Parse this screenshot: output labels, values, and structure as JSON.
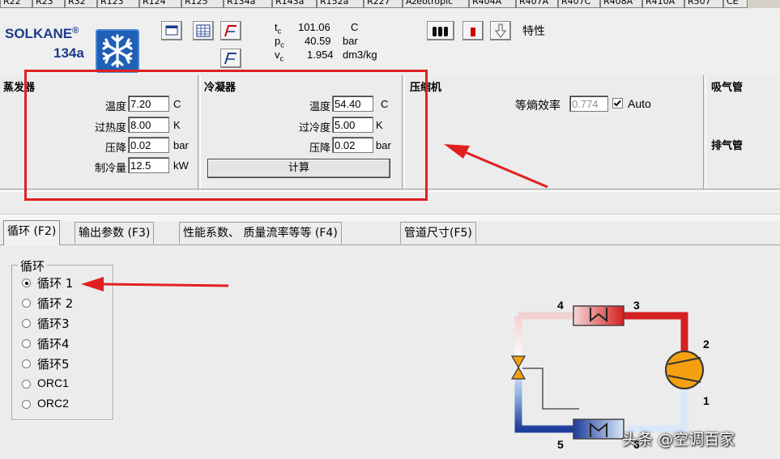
{
  "refrigerant_tabs": [
    "R22",
    "R23",
    "R32",
    "R123",
    "R124",
    "R125",
    "R134a",
    "R143a",
    "R152a",
    "R227",
    "Azeotropic",
    "R404A",
    "R407A",
    "R407C",
    "R408A",
    "R410A",
    "R507",
    "CE"
  ],
  "logo": {
    "brand": "SOLKANE",
    "reg": "®",
    "model": "134a"
  },
  "critical": {
    "tc_sym": "t",
    "tc_sub": "c",
    "tc_val": "101.06",
    "tc_unit": "C",
    "pc_sym": "p",
    "pc_sub": "c",
    "pc_val": "40.59",
    "pc_unit": "bar",
    "vc_sym": "v",
    "vc_sub": "c",
    "vc_val": "1.954",
    "vc_unit": "dm3/kg"
  },
  "toolbar": {
    "properties_label": "特性"
  },
  "evaporator": {
    "title": "蒸发器",
    "temp_label": "温度",
    "temp_value": "7.20",
    "temp_unit": "C",
    "superheat_label": "过热度",
    "superheat_value": "8.00",
    "superheat_unit": "K",
    "pdrop_label": "压降",
    "pdrop_value": "0.02",
    "pdrop_unit": "bar",
    "capacity_label": "制冷量",
    "capacity_value": "12.5",
    "capacity_unit": "kW"
  },
  "condenser": {
    "title": "冷凝器",
    "temp_label": "温度",
    "temp_value": "54.40",
    "temp_unit": "C",
    "subcool_label": "过冷度",
    "subcool_value": "5.00",
    "subcool_unit": "K",
    "pdrop_label": "压降",
    "pdrop_value": "0.02",
    "pdrop_unit": "bar",
    "calc_label": "计算"
  },
  "compressor": {
    "title": "压缩机",
    "eff_label": "等熵效率",
    "eff_value": "0.774",
    "auto_label": "Auto",
    "auto_checked": true
  },
  "lines": {
    "suction": "吸气管",
    "discharge": "排气管"
  },
  "tabs": [
    {
      "label": "循环 (F2)",
      "active": true
    },
    {
      "label": "输出参数 (F3)",
      "active": false
    },
    {
      "label": "性能系数、 质量流率等等 (F4)",
      "active": false
    },
    {
      "label": "管道尺寸(F5)",
      "active": false
    }
  ],
  "cycle_group": {
    "title": "循环",
    "options": [
      "循环 1",
      "循环 2",
      "循环3",
      "循环4",
      "循环5",
      "ORC1",
      "ORC2"
    ],
    "selected": 0
  },
  "diagram_labels": {
    "p1": "1",
    "p2": "2",
    "p3": "3",
    "p4": "4",
    "p5": "5",
    "p6": "6"
  },
  "watermark": "头条 @空调百家",
  "colors": {
    "highlight_red": "#e02020",
    "hot": "#d42020",
    "cold": "#1e3c9c",
    "compressor": "#f5a010"
  }
}
